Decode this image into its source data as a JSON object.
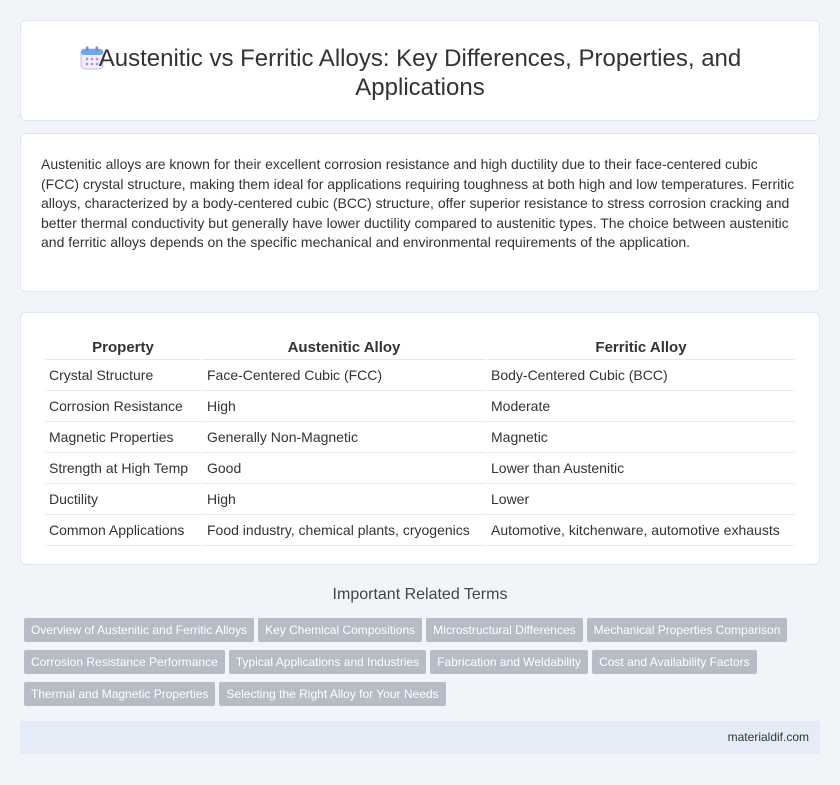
{
  "header": {
    "icon": "calendar-icon",
    "title": "Austenitic vs Ferritic Alloys: Key Differences, Properties, and Applications"
  },
  "intro": {
    "text": "Austenitic alloys are known for their excellent corrosion resistance and high ductility due to their face-centered cubic (FCC) crystal structure, making them ideal for applications requiring toughness at both high and low temperatures. Ferritic alloys, characterized by a body-centered cubic (BCC) structure, offer superior resistance to stress corrosion cracking and better thermal conductivity but generally have lower ductility compared to austenitic types. The choice between austenitic and ferritic alloys depends on the specific mechanical and environmental requirements of the application."
  },
  "table": {
    "headers": [
      "Property",
      "Austenitic Alloy",
      "Ferritic Alloy"
    ],
    "rows": [
      [
        "Crystal Structure",
        "Face-Centered Cubic (FCC)",
        "Body-Centered Cubic (BCC)"
      ],
      [
        "Corrosion Resistance",
        "High",
        "Moderate"
      ],
      [
        "Magnetic Properties",
        "Generally Non-Magnetic",
        "Magnetic"
      ],
      [
        "Strength at High Temp",
        "Good",
        "Lower than Austenitic"
      ],
      [
        "Ductility",
        "High",
        "Lower"
      ],
      [
        "Common Applications",
        "Food industry, chemical plants, cryogenics",
        "Automotive, kitchenware, automotive exhausts"
      ]
    ]
  },
  "related": {
    "heading": "Important Related Terms",
    "tags": [
      "Overview of Austenitic and Ferritic Alloys",
      "Key Chemical Compositions",
      "Microstructural Differences",
      "Mechanical Properties Comparison",
      "Corrosion Resistance Performance",
      "Typical Applications and Industries",
      "Fabrication and Weldability",
      "Cost and Availability Factors",
      "Thermal and Magnetic Properties",
      "Selecting the Right Alloy for Your Needs"
    ]
  },
  "footer": {
    "site": "materialdif.com"
  }
}
